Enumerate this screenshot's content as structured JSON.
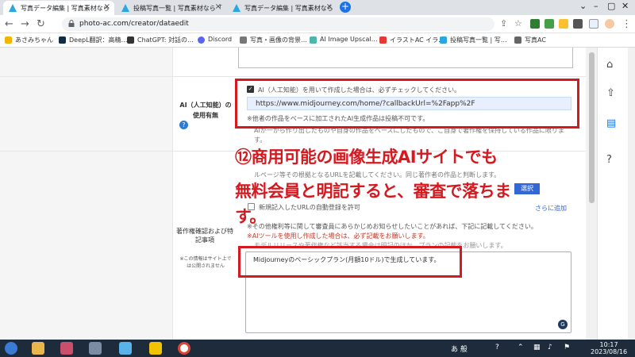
{
  "browser": {
    "tabs": [
      {
        "title": "写真データ編集 | 写真素材なら",
        "active": true
      },
      {
        "title": "投稿写真一覧 | 写真素材なら「",
        "active": false
      },
      {
        "title": "写真データ編集 | 写真素材なら",
        "active": false
      }
    ],
    "url": "photo-ac.com/creator/dataedit",
    "bookmarks": [
      "あさみちゃん",
      "DeepL翻訳：高精…",
      "ChatGPT: 対話の…",
      "Discord",
      "写真・画像の背景…",
      "AI Image Upscal…",
      "イラストAC イラ…",
      "投稿写真一覧 | 写…",
      "写真AC"
    ]
  },
  "form": {
    "ai_label": "AI（人工知能）の使用有無",
    "ai_checkbox_label": "AI（人工知能）を用いて作成した場合は、必ずチェックしてください。",
    "ai_url": "https://www.midjourney.com/home/?callbackUrl=%2Fapp%2F",
    "ai_note": "※他者の作品をベースに加工されたAI生成作品は投稿不可です。",
    "ai_note2": "AIが一から作り出したものや自身の作品をベースにしたもので、ご自身で著作権を保持している作品に限りま",
    "ai_note3": "す。",
    "url_note": "ルページ等その根拠となるURLを記載してください。同じ著作者の作品と判断します。",
    "select_label": "選択",
    "auto_register_label": "新規記入したURLの自動登録を許可",
    "more_link": "さらに追加",
    "copyright_label": "著作権確認および特記事項",
    "copyright_note": "※この情報はサイト上では公開されません",
    "copyright_note1": "※その他権利等に関して審査員にあらかじめお知らせしたいことがあれば、下記に記載してください。",
    "copyright_note2": "※AIツールを使用し作成した場合は、必ず記載をお願いします。",
    "copyright_note3": "モデルリリースや著作権など該当する場合は明記のほか、プランの記載をお願いします。",
    "remarks_text": "Midjourneyのベーシックプラン(月額10ドル)で生成しています。"
  },
  "annotation": {
    "line1": "⑫商用可能の画像生成AIサイトでも",
    "line2": "無料会員と明記すると、審査で落ちま",
    "line3": "す。"
  },
  "taskbar": {
    "ime": "あ 般",
    "time": "10:17",
    "date": "2023/08/16"
  },
  "colors": {
    "accent_red": "#d6181f",
    "link_blue": "#3367d6"
  }
}
